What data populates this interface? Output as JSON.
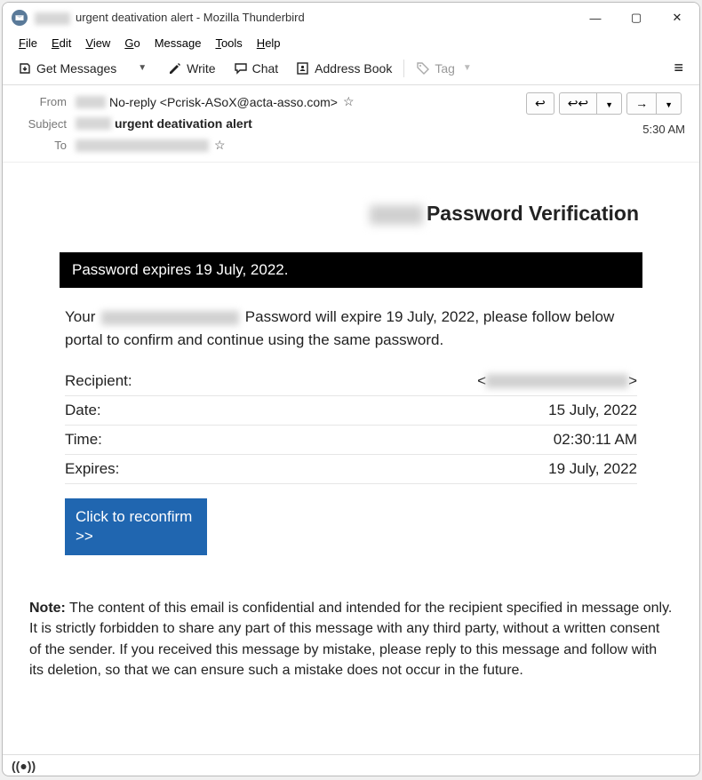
{
  "window": {
    "title_suffix": "urgent deativation alert - Mozilla Thunderbird"
  },
  "menu": {
    "file": "File",
    "edit": "Edit",
    "view": "View",
    "go": "Go",
    "message": "Message",
    "tools": "Tools",
    "help": "Help"
  },
  "toolbar": {
    "get_messages": "Get Messages",
    "write": "Write",
    "chat": "Chat",
    "address_book": "Address Book",
    "tag": "Tag"
  },
  "headers": {
    "from_label": "From",
    "from_value": "No-reply <Pcrisk-ASoX@acta-asso.com>",
    "subject_label": "Subject",
    "subject_value": "urgent deativation alert",
    "to_label": "To",
    "time": "5:30 AM"
  },
  "mail": {
    "title_suffix": "Password Verification",
    "black_bar": "Password expires 19 July, 2022.",
    "para_prefix": "Your ",
    "para_suffix": " Password will expire 19 July, 2022, please follow below portal to confirm and continue using the same password.",
    "rows": {
      "recipient_label": "Recipient:",
      "recipient_lt": "<",
      "recipient_gt": ">",
      "date_label": "Date:",
      "date_value": "15 July, 2022",
      "time_label": "Time:",
      "time_value": "02:30:11 AM",
      "expires_label": "Expires:",
      "expires_value": "19 July, 2022"
    },
    "cta_line1": "Click to reconfirm",
    "cta_line2": ">>",
    "note_label": "Note:",
    "note_body": " The content of this email is confidential and intended for the recipient specified in message only. It is strictly forbidden to share any part of this message with any third party, without a written consent of the sender. If you received this message by mistake, please reply to this message and follow with its deletion, so that we can ensure such a mistake does not occur in the future."
  }
}
